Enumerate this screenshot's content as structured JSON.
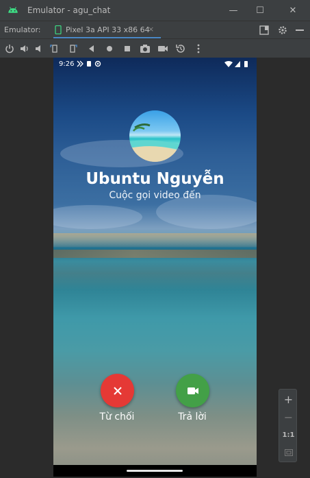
{
  "window": {
    "title": "Emulator - agu_chat",
    "minimize_label": "—",
    "maximize_label": "☐",
    "close_label": "✕"
  },
  "tabbar": {
    "label": "Emulator:",
    "tab_label": "Pixel 3a API 33 x86 64",
    "tab_close": "×"
  },
  "toolbar": {
    "icons": [
      "power-icon",
      "volume-up-icon",
      "volume-down-icon",
      "rotate-left-icon",
      "rotate-right-icon",
      "back-icon",
      "home-icon",
      "overview-icon",
      "screenshot-icon",
      "screen-record-icon",
      "snapshot-icon",
      "more-icon"
    ]
  },
  "phone": {
    "status_time": "9:26",
    "caller_name": "Ubuntu Nguyễn",
    "call_subtitle": "Cuộc gọi video đến",
    "decline_label": "Từ chối",
    "accept_label": "Trả lời",
    "decline_color": "#e53935",
    "accept_color": "#43a047"
  },
  "zoom": {
    "zoom_in": "+",
    "zoom_out": "−",
    "one_to_one": "1:1"
  }
}
